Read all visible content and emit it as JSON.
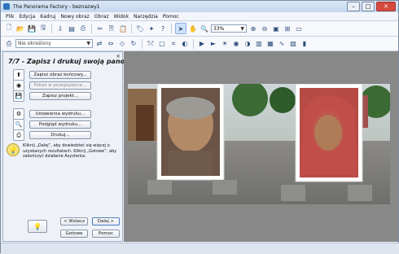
{
  "window": {
    "title": "The Panorama Factory - beznazwy1"
  },
  "menu": {
    "items": [
      "Plik",
      "Edycja",
      "Kadruj",
      "Nowy obraz",
      "Obraz",
      "Widok",
      "Narzędzia",
      "Pomoc"
    ]
  },
  "toolbar": {
    "zoom_value": "33%"
  },
  "toolbar2": {
    "print_select_value": "Nie określony"
  },
  "wizard": {
    "title": "7/7 - Zapisz i drukuj swoją panoramę",
    "buttons": {
      "save_final": "Zapisz obraz końcowy...",
      "show_in_browser": "Pokaż w przeglądarce...",
      "save_project": "Zapisz projekt...",
      "print_settings": "Ustawienia wydruku...",
      "print_preview": "Podgląd wydruku...",
      "print": "Drukuj..."
    },
    "info_text": "Kliknij „Dalej”, aby dowiedzieć się więcej o uzyskanych rezultatach. Kliknij „Gotowe”, aby zakończyć działanie Asystenta.",
    "nav": {
      "back": "< Wstecz",
      "next": "Dalej >",
      "finish": "Gotowe",
      "help": "Pomoc"
    }
  },
  "colors": {
    "accent": "#2f74c0",
    "canvas_bg": "#888888"
  }
}
